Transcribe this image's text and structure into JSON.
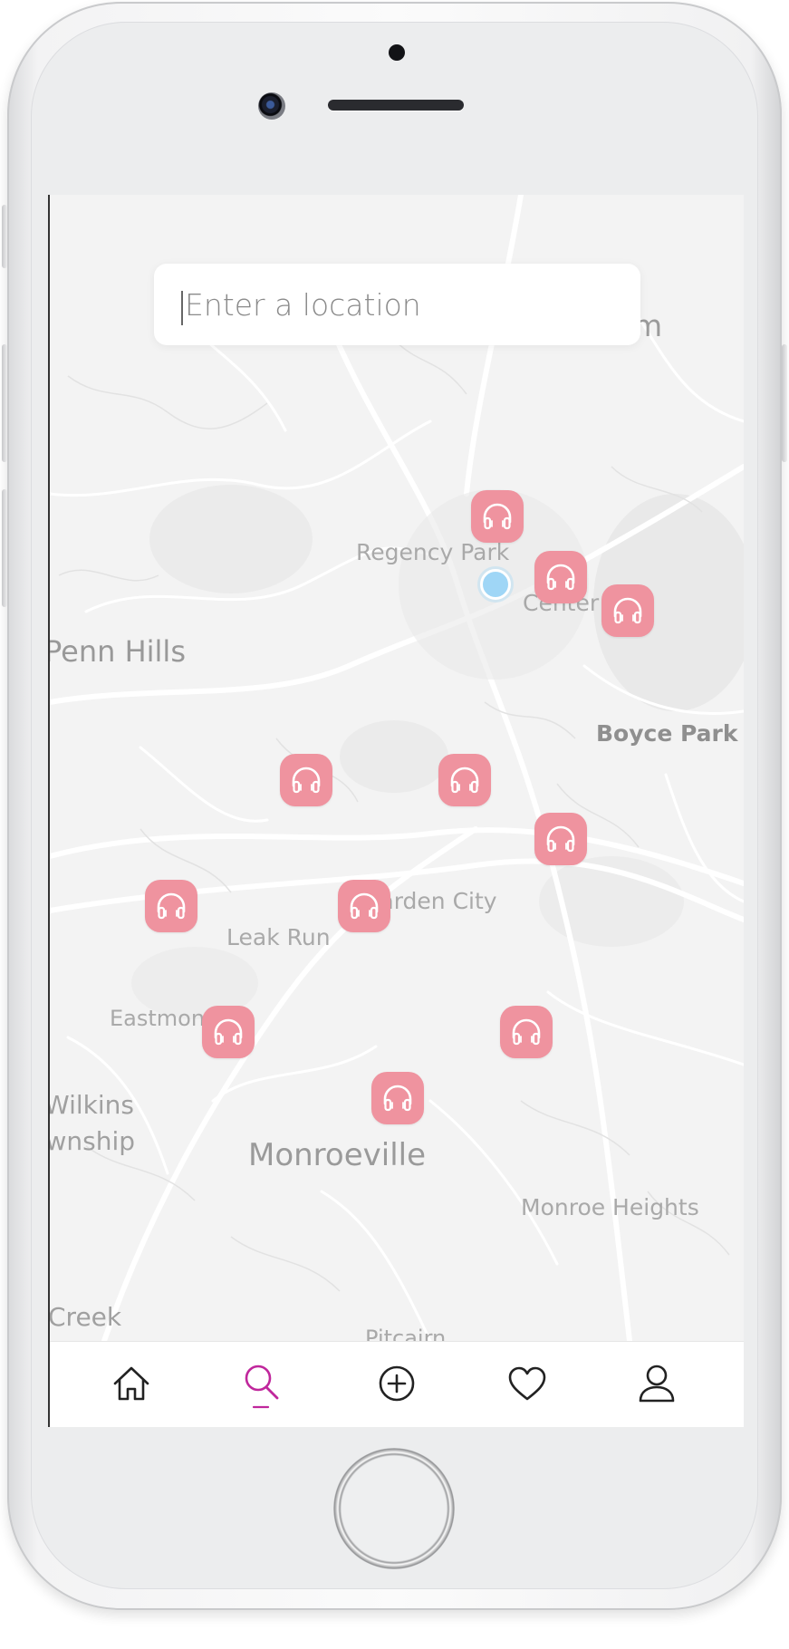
{
  "search": {
    "placeholder": "Enter a location"
  },
  "map": {
    "labels": {
      "plum": "Plum",
      "regency_park": "Regency Park",
      "center": "Center",
      "penn_hills": "Penn Hills",
      "boyce_park": "Boyce Park",
      "garden_city": "Garden City",
      "leak_run": "Leak Run",
      "eastmont": "Eastmont",
      "wilkins": "Wilkins",
      "township": "Township",
      "monroeville": "Monroeville",
      "monroe_heights": "Monroe Heights",
      "creek": "Creek",
      "pitcairn": "Pitcairn"
    },
    "pin_icon": "headphones-icon",
    "pin_color": "#ef939f",
    "location_color": "#9fd6f6"
  },
  "tabbar": {
    "items": [
      {
        "name": "home",
        "icon": "home-icon"
      },
      {
        "name": "search",
        "icon": "search-icon",
        "active": true
      },
      {
        "name": "add",
        "icon": "plus-circle-icon"
      },
      {
        "name": "favorites",
        "icon": "heart-icon"
      },
      {
        "name": "profile",
        "icon": "user-icon"
      }
    ],
    "active_color": "#c0279c"
  }
}
